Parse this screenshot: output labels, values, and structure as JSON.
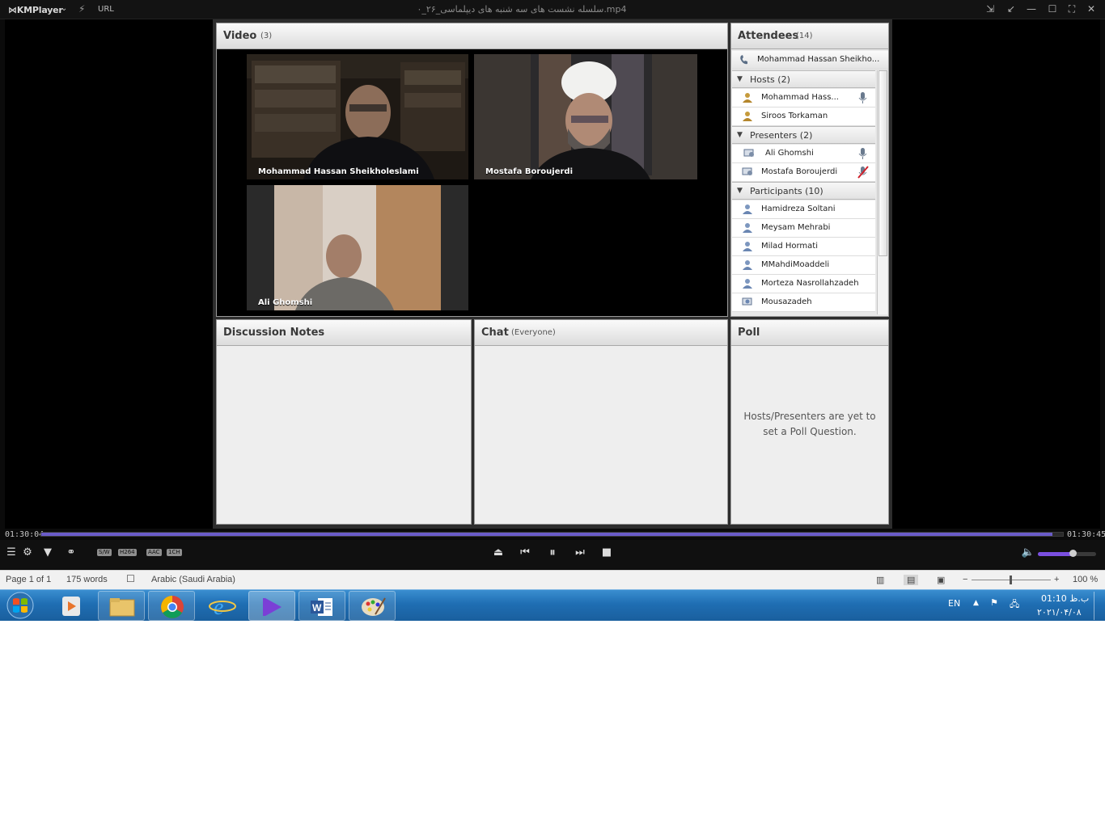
{
  "player": {
    "app_name": "KMPlayer",
    "url_label": "URL",
    "file_title": "سلسله نشست های سه شنبه های دیپلماسی_۲۶_۰.mp4",
    "time_current": "01:30:04",
    "time_total": "01:30:45",
    "progress_fraction": 0.99,
    "volume_fraction": 0.6,
    "badges": [
      "S/W",
      "H264",
      "AAC",
      "1CH"
    ]
  },
  "meeting": {
    "video_pod": {
      "title": "Video",
      "count": "(3)"
    },
    "video_tiles": [
      {
        "name": "Mohammad Hassan Sheikholeslami"
      },
      {
        "name": "Mostafa Boroujerdi"
      },
      {
        "name": "Ali Ghomshi"
      }
    ],
    "attendees_pod": {
      "title": "Attendees",
      "count": "(14)",
      "speaker_row": "Mohammad Hassan Sheikho..."
    },
    "groups": {
      "hosts": {
        "label": "Hosts (2)",
        "members": [
          "Mohammad Hass...",
          "Siroos Torkaman"
        ]
      },
      "presenters": {
        "label": "Presenters (2)",
        "members": [
          "Ali Ghomshi",
          "Mostafa Boroujerdi"
        ]
      },
      "participants": {
        "label": "Participants (10)",
        "members": [
          "Hamidreza Soltani",
          "Meysam Mehrabi",
          "Milad Hormati",
          "MMahdiMoaddeli",
          "Morteza Nasrollahzadeh",
          "Mousazadeh"
        ]
      }
    },
    "notes_pod": {
      "title": "Discussion Notes"
    },
    "chat_pod": {
      "title": "Chat",
      "scope": "(Everyone)"
    },
    "poll_pod": {
      "title": "Poll",
      "message": "Hosts/Presenters are yet to set a Poll Question."
    }
  },
  "word_status": {
    "page": "Page 1 of 1",
    "words": "175 words",
    "language": "Arabic (Saudi Arabia)",
    "zoom": "100 %"
  },
  "taskbar": {
    "lang": "EN",
    "time": "01:10 ب.ظ",
    "date": "۲۰۲۱/۰۴/۰۸"
  },
  "colors": {
    "seek_fill": "#6a5cc8",
    "volume_fill": "#7a4fe0",
    "taskbar": "#1f6eb3"
  }
}
